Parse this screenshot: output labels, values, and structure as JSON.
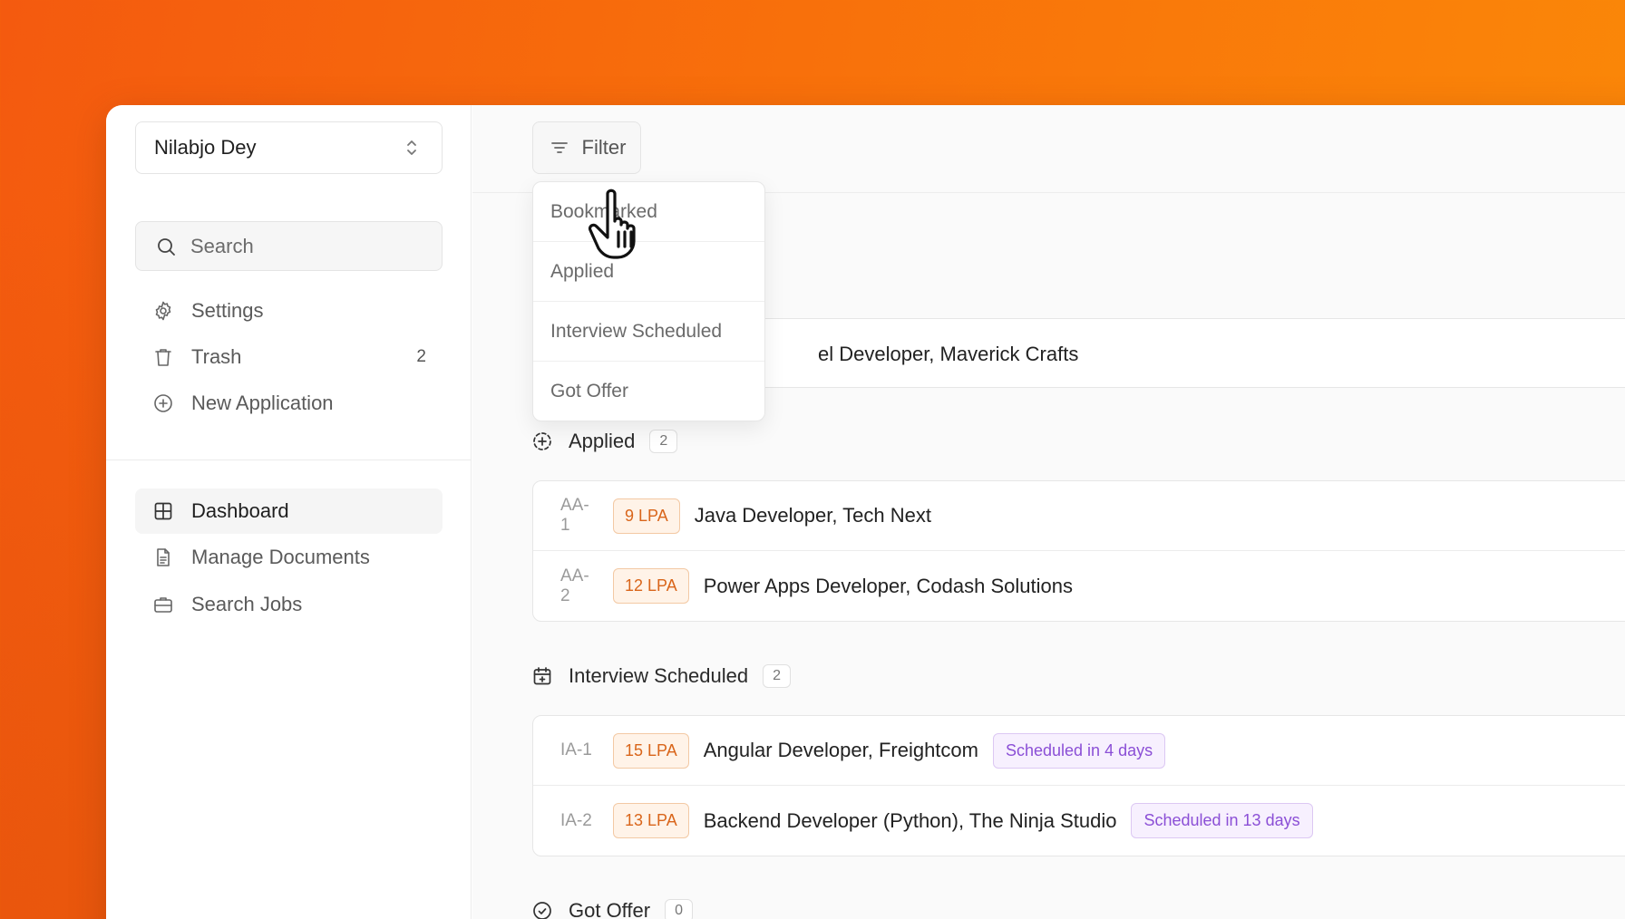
{
  "sidebar": {
    "user_name": "Nilabjo Dey",
    "search_placeholder": "Search",
    "settings_label": "Settings",
    "trash_label": "Trash",
    "trash_count": "2",
    "new_application_label": "New Application",
    "dashboard_label": "Dashboard",
    "manage_documents_label": "Manage Documents",
    "search_jobs_label": "Search Jobs"
  },
  "toolbar": {
    "filter_label": "Filter"
  },
  "filter_menu": {
    "items": [
      "Bookmarked",
      "Applied",
      "Interview Scheduled",
      "Got Offer"
    ]
  },
  "bookmarked_partial_row": {
    "title_visible": "el Developer, Maverick Crafts"
  },
  "sections": {
    "applied": {
      "label": "Applied",
      "count": "2",
      "rows": [
        {
          "id": "AA-1",
          "salary": "9 LPA",
          "title": "Java Developer, Tech Next"
        },
        {
          "id": "AA-2",
          "salary": "12 LPA",
          "title": "Power Apps Developer, Codash Solutions"
        }
      ]
    },
    "interview": {
      "label": "Interview Scheduled",
      "count": "2",
      "rows": [
        {
          "id": "IA-1",
          "salary": "15 LPA",
          "title": "Angular Developer, Freightcom",
          "schedule": "Scheduled in 4 days"
        },
        {
          "id": "IA-2",
          "salary": "13 LPA",
          "title": "Backend Developer (Python), The Ninja Studio",
          "schedule": "Scheduled in 13 days"
        }
      ]
    },
    "offer": {
      "label": "Got Offer",
      "count": "0"
    }
  },
  "colors": {
    "accent_orange": "#f8700b",
    "lpa_text": "#d9651a",
    "schedule_text": "#8b4fd6"
  },
  "icons": {
    "user_select": "chevron-up-down-icon",
    "search": "search-icon",
    "settings": "gear-icon",
    "trash": "trash-icon",
    "new_application": "plus-circle-icon",
    "dashboard": "grid-icon",
    "documents": "document-icon",
    "jobs": "briefcase-icon",
    "filter": "filter-lines-icon",
    "applied": "dashed-plus-circle-icon",
    "interview": "calendar-icon",
    "offer": "check-circle-icon",
    "cursor": "hand-pointer-icon"
  }
}
